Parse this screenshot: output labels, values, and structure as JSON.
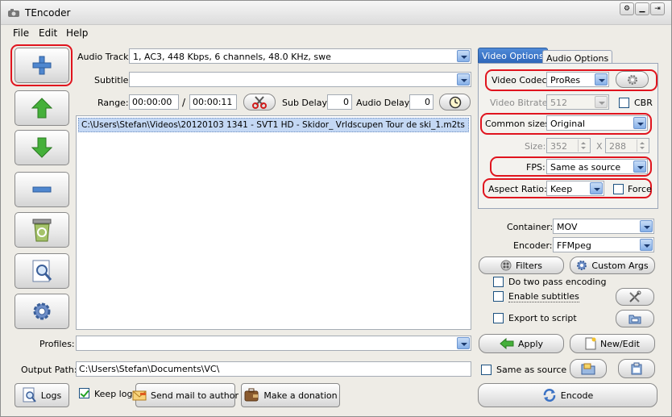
{
  "window": {
    "title": "TEncoder"
  },
  "menu": {
    "file": "File",
    "edit": "Edit",
    "help": "Help"
  },
  "audio_track": {
    "label": "Audio Track:",
    "value": "1, AC3, 448 Kbps, 6 channels, 48.0 KHz, swe"
  },
  "subtitle": {
    "label": "Subtitle:",
    "value": ""
  },
  "range": {
    "label": "Range:",
    "start": "00:00:00",
    "separator": "/",
    "end": "00:00:11"
  },
  "sub_delay": {
    "label": "Sub Delay:",
    "value": "0"
  },
  "audio_delay": {
    "label": "Audio Delay:",
    "value": "0"
  },
  "file_list": {
    "items": [
      "C:\\Users\\Stefan\\Videos\\20120103 1341 - SVT1 HD - Skidor_ Vrldscupen Tour de ski_1.m2ts"
    ]
  },
  "profiles": {
    "label": "Profiles:",
    "value": ""
  },
  "output_path": {
    "label": "Output Path:",
    "value": "C:\\Users\\Stefan\\Documents\\VC\\"
  },
  "bottom_buttons": {
    "logs": "Logs",
    "keep_log": "Keep log",
    "send_mail": "Send mail to author",
    "donation": "Make a donation"
  },
  "tabs": {
    "video": "Video Options",
    "audio": "Audio Options"
  },
  "video": {
    "codec_label": "Video Codec:",
    "codec_value": "ProRes",
    "bitrate_label": "Video Bitrate:",
    "bitrate_value": "512",
    "cbr_label": "CBR",
    "sizes_label": "Common sizes:",
    "sizes_value": "Original",
    "size_label": "Size:",
    "width": "352",
    "x": "X",
    "height": "288",
    "fps_label": "FPS:",
    "fps_value": "Same as source",
    "aspect_label": "Aspect Ratio:",
    "aspect_value": "Keep",
    "force_label": "Force"
  },
  "container": {
    "label": "Container:",
    "value": "MOV"
  },
  "encoder": {
    "label": "Encoder:",
    "value": "FFMpeg"
  },
  "right_buttons": {
    "filters": "Filters",
    "custom_args": "Custom Args",
    "two_pass": "Do two pass encoding",
    "enable_subtitles": "Enable subtitles",
    "export_script": "Export to script",
    "apply": "Apply",
    "new_edit": "New/Edit",
    "same_as_source": "Same as source",
    "encode": "Encode"
  },
  "colors": {
    "highlight": "#e0141e",
    "selection": "#c4d8f4",
    "tab_active": "#2c64b8"
  },
  "icons": [
    "app-icon",
    "plus-icon",
    "arrow-up-icon",
    "arrow-down-icon",
    "minus-icon",
    "recycle-bin-icon",
    "preview-icon",
    "gear-icon",
    "scissors-icon",
    "clock-icon",
    "settings-icon",
    "filters-icon",
    "custom-args-icon",
    "tools-icon",
    "folder-icon",
    "apply-arrow-icon",
    "new-edit-icon",
    "encode-icon",
    "logs-icon",
    "mail-icon",
    "donation-icon"
  ]
}
